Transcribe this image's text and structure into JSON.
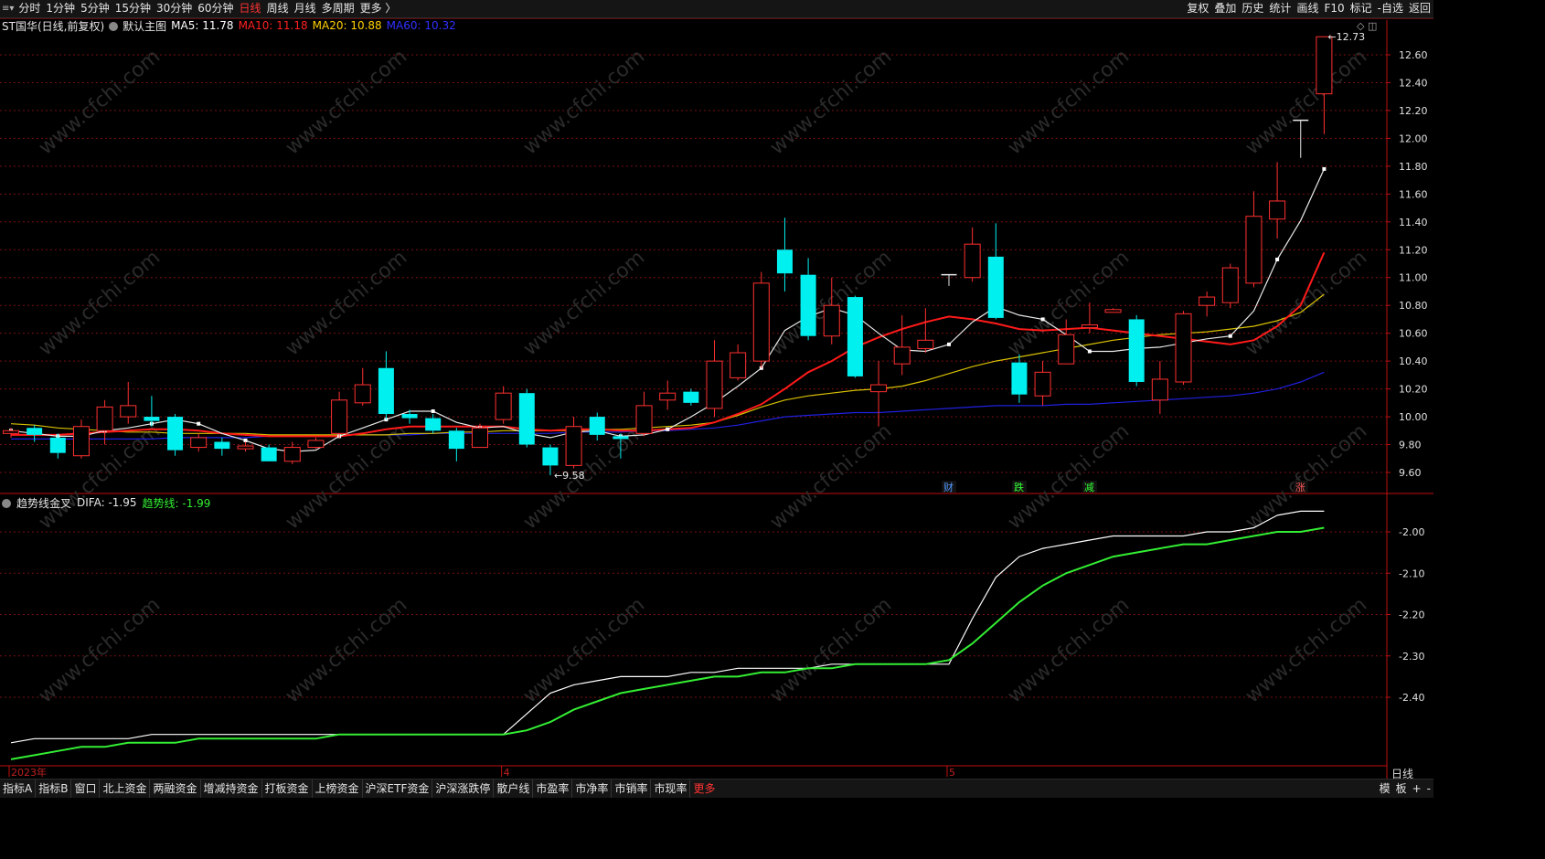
{
  "toolbar": {
    "left": [
      "分时",
      "1分钟",
      "5分钟",
      "15分钟",
      "30分钟",
      "60分钟",
      "日线",
      "周线",
      "月线",
      "多周期",
      "更多 〉"
    ],
    "active": "日线",
    "right": [
      "复权",
      "叠加",
      "历史",
      "统计",
      "画线",
      "F10",
      "标记",
      "-自选",
      "返回"
    ]
  },
  "info": {
    "stock": "ST国华(日线,前复权)",
    "template": "默认主图",
    "ma5": "MA5: 11.78",
    "ma10": "MA10: 11.18",
    "ma20": "MA20: 10.88",
    "ma60": "MA60: 10.32",
    "colors": {
      "ma5": "#ffffff",
      "ma10": "#ff2020",
      "ma20": "#ffd000",
      "ma60": "#3030ff"
    }
  },
  "sub_info": {
    "name": "趋势线金叉",
    "difa": "DIFA: -1.95",
    "trend": "趋势线: -1.99"
  },
  "bottom": {
    "tabs": [
      "指标A",
      "指标B",
      "窗口",
      "北上资金",
      "两融资金",
      "增减持资金",
      "打板资金",
      "上榜资金",
      "沪深ETF资金",
      "沪深涨跌停",
      "散户线",
      "市盈率",
      "市净率",
      "市销率",
      "市现率",
      "更多"
    ],
    "right": [
      "模",
      "板",
      "+",
      "-"
    ],
    "period": "日线"
  },
  "chart_data": [
    {
      "type": "candlestick",
      "y_ticks": [
        "12.60",
        "12.40",
        "12.20",
        "12.00",
        "11.80",
        "11.60",
        "11.40",
        "11.20",
        "11.00",
        "10.80",
        "10.60",
        "10.40",
        "10.20",
        "10.00",
        "9.80",
        "9.60"
      ],
      "ylim": [
        9.5,
        12.8
      ],
      "x_labels": [
        {
          "index": 0,
          "label": "2023年"
        },
        {
          "index": 21,
          "label": "4"
        },
        {
          "index": 40,
          "label": "5"
        }
      ],
      "annotations": [
        {
          "text": "12.73",
          "index": 56,
          "value": 12.73
        },
        {
          "text": "9.58",
          "index": 23,
          "value": 9.58
        }
      ],
      "markers": [
        {
          "text": "财",
          "index": 40,
          "color": "#5599ff"
        },
        {
          "text": "跌",
          "index": 43,
          "color": "#33ff33"
        },
        {
          "text": "减",
          "index": 46,
          "color": "#33ff33"
        },
        {
          "text": "涨",
          "index": 55,
          "color": "#ff5555"
        }
      ],
      "candles": [
        {
          "o": 9.88,
          "c": 9.9,
          "h": 9.92,
          "l": 9.85
        },
        {
          "o": 9.92,
          "c": 9.87,
          "h": 9.94,
          "l": 9.82
        },
        {
          "o": 9.85,
          "c": 9.74,
          "h": 9.88,
          "l": 9.7
        },
        {
          "o": 9.72,
          "c": 9.93,
          "h": 9.98,
          "l": 9.7
        },
        {
          "o": 9.9,
          "c": 10.07,
          "h": 10.12,
          "l": 9.8
        },
        {
          "o": 10.0,
          "c": 10.08,
          "h": 10.25,
          "l": 9.95
        },
        {
          "o": 10.0,
          "c": 9.97,
          "h": 10.15,
          "l": 9.93
        },
        {
          "o": 10.0,
          "c": 9.76,
          "h": 10.02,
          "l": 9.72
        },
        {
          "o": 9.78,
          "c": 9.85,
          "h": 9.88,
          "l": 9.75
        },
        {
          "o": 9.82,
          "c": 9.77,
          "h": 9.85,
          "l": 9.72
        },
        {
          "o": 9.77,
          "c": 9.79,
          "h": 9.82,
          "l": 9.75
        },
        {
          "o": 9.78,
          "c": 9.68,
          "h": 9.8,
          "l": 9.68
        },
        {
          "o": 9.68,
          "c": 9.78,
          "h": 9.82,
          "l": 9.66
        },
        {
          "o": 9.78,
          "c": 9.83,
          "h": 9.85,
          "l": 9.77
        },
        {
          "o": 9.88,
          "c": 10.12,
          "h": 10.18,
          "l": 9.85
        },
        {
          "o": 10.1,
          "c": 10.23,
          "h": 10.35,
          "l": 10.08
        },
        {
          "o": 10.35,
          "c": 10.02,
          "h": 10.47,
          "l": 9.98
        },
        {
          "o": 10.02,
          "c": 9.99,
          "h": 10.05,
          "l": 9.95
        },
        {
          "o": 9.99,
          "c": 9.9,
          "h": 10.02,
          "l": 9.88
        },
        {
          "o": 9.9,
          "c": 9.77,
          "h": 9.92,
          "l": 9.68
        },
        {
          "o": 9.78,
          "c": 9.92,
          "h": 9.95,
          "l": 9.78
        },
        {
          "o": 9.98,
          "c": 10.17,
          "h": 10.22,
          "l": 9.95
        },
        {
          "o": 10.17,
          "c": 9.8,
          "h": 10.2,
          "l": 9.78
        },
        {
          "o": 9.78,
          "c": 9.65,
          "h": 9.8,
          "l": 9.58
        },
        {
          "o": 9.65,
          "c": 9.93,
          "h": 10.0,
          "l": 9.63
        },
        {
          "o": 10.0,
          "c": 9.87,
          "h": 10.03,
          "l": 9.83
        },
        {
          "o": 9.86,
          "c": 9.84,
          "h": 9.88,
          "l": 9.7
        },
        {
          "o": 9.88,
          "c": 10.08,
          "h": 10.18,
          "l": 9.86
        },
        {
          "o": 10.12,
          "c": 10.17,
          "h": 10.26,
          "l": 10.05
        },
        {
          "o": 10.18,
          "c": 10.1,
          "h": 10.2,
          "l": 10.08
        },
        {
          "o": 10.06,
          "c": 10.4,
          "h": 10.55,
          "l": 10.0
        },
        {
          "o": 10.28,
          "c": 10.46,
          "h": 10.52,
          "l": 10.26
        },
        {
          "o": 10.4,
          "c": 10.96,
          "h": 11.04,
          "l": 10.35
        },
        {
          "o": 11.2,
          "c": 11.03,
          "h": 11.43,
          "l": 10.9
        },
        {
          "o": 11.02,
          "c": 10.58,
          "h": 11.14,
          "l": 10.55
        },
        {
          "o": 10.58,
          "c": 10.8,
          "h": 11.0,
          "l": 10.52
        },
        {
          "o": 10.86,
          "c": 10.29,
          "h": 10.87,
          "l": 10.28
        },
        {
          "o": 10.18,
          "c": 10.23,
          "h": 10.4,
          "l": 9.93
        },
        {
          "o": 10.38,
          "c": 10.5,
          "h": 10.73,
          "l": 10.3
        },
        {
          "o": 10.49,
          "c": 10.55,
          "h": 10.78,
          "l": 10.46
        },
        {
          "o": 11.02,
          "c": 11.02,
          "h": 11.02,
          "l": 10.94
        },
        {
          "o": 11.0,
          "c": 11.24,
          "h": 11.36,
          "l": 10.97
        },
        {
          "o": 11.15,
          "c": 10.71,
          "h": 11.39,
          "l": 10.7
        },
        {
          "o": 10.39,
          "c": 10.16,
          "h": 10.45,
          "l": 10.1
        },
        {
          "o": 10.15,
          "c": 10.32,
          "h": 10.4,
          "l": 10.08
        },
        {
          "o": 10.38,
          "c": 10.59,
          "h": 10.7,
          "l": 10.38
        },
        {
          "o": 10.64,
          "c": 10.66,
          "h": 10.82,
          "l": 10.6
        },
        {
          "o": 10.75,
          "c": 10.77,
          "h": 10.78,
          "l": 10.75
        },
        {
          "o": 10.7,
          "c": 10.25,
          "h": 10.73,
          "l": 10.22
        },
        {
          "o": 10.12,
          "c": 10.27,
          "h": 10.4,
          "l": 10.02
        },
        {
          "o": 10.25,
          "c": 10.74,
          "h": 10.76,
          "l": 10.23
        },
        {
          "o": 10.8,
          "c": 10.86,
          "h": 10.9,
          "l": 10.72
        },
        {
          "o": 10.82,
          "c": 11.07,
          "h": 11.1,
          "l": 10.78
        },
        {
          "o": 10.96,
          "c": 11.44,
          "h": 11.62,
          "l": 10.93
        },
        {
          "o": 11.42,
          "c": 11.55,
          "h": 11.83,
          "l": 11.28
        },
        {
          "o": 12.13,
          "c": 12.13,
          "h": 12.13,
          "l": 11.86
        },
        {
          "o": 12.32,
          "c": 12.73,
          "h": 12.73,
          "l": 12.03
        }
      ],
      "ma5": [
        9.9,
        9.88,
        9.86,
        9.86,
        9.9,
        9.92,
        9.95,
        9.98,
        9.95,
        9.88,
        9.83,
        9.77,
        9.75,
        9.76,
        9.86,
        9.92,
        9.98,
        10.04,
        10.04,
        9.96,
        9.92,
        9.93,
        9.88,
        9.85,
        9.89,
        9.9,
        9.86,
        9.87,
        9.91,
        10.0,
        10.1,
        10.22,
        10.35,
        10.62,
        10.72,
        10.78,
        10.73,
        10.6,
        10.48,
        10.47,
        10.52,
        10.68,
        10.79,
        10.73,
        10.7,
        10.59,
        10.47,
        10.47,
        10.49,
        10.5,
        10.53,
        10.56,
        10.58,
        10.76,
        11.13,
        11.41,
        11.78
      ],
      "ma10": [
        9.87,
        9.87,
        9.87,
        9.88,
        9.89,
        9.9,
        9.91,
        9.91,
        9.9,
        9.88,
        9.87,
        9.86,
        9.86,
        9.86,
        9.86,
        9.88,
        9.91,
        9.93,
        9.93,
        9.93,
        9.93,
        9.93,
        9.91,
        9.9,
        9.91,
        9.91,
        9.9,
        9.9,
        9.91,
        9.92,
        9.96,
        10.02,
        10.09,
        10.2,
        10.32,
        10.4,
        10.5,
        10.57,
        10.63,
        10.68,
        10.72,
        10.7,
        10.67,
        10.63,
        10.62,
        10.63,
        10.64,
        10.62,
        10.6,
        10.58,
        10.56,
        10.54,
        10.52,
        10.55,
        10.65,
        10.8,
        11.18
      ],
      "ma20": [
        9.95,
        9.94,
        9.92,
        9.91,
        9.9,
        9.89,
        9.89,
        9.88,
        9.88,
        9.88,
        9.88,
        9.87,
        9.87,
        9.87,
        9.87,
        9.87,
        9.87,
        9.88,
        9.88,
        9.89,
        9.89,
        9.9,
        9.9,
        9.9,
        9.9,
        9.91,
        9.91,
        9.92,
        9.93,
        9.94,
        9.96,
        10.01,
        10.07,
        10.12,
        10.15,
        10.17,
        10.19,
        10.2,
        10.22,
        10.26,
        10.31,
        10.36,
        10.4,
        10.43,
        10.46,
        10.49,
        10.52,
        10.55,
        10.57,
        10.59,
        10.6,
        10.61,
        10.63,
        10.65,
        10.69,
        10.75,
        10.88
      ],
      "ma60": [
        9.84,
        9.84,
        9.84,
        9.84,
        9.84,
        9.84,
        9.84,
        9.85,
        9.85,
        9.85,
        9.85,
        9.86,
        9.86,
        9.86,
        9.87,
        9.87,
        9.87,
        9.87,
        9.88,
        9.88,
        9.88,
        9.88,
        9.88,
        9.88,
        9.89,
        9.89,
        9.89,
        9.9,
        9.9,
        9.91,
        9.92,
        9.94,
        9.97,
        10.0,
        10.01,
        10.02,
        10.03,
        10.03,
        10.04,
        10.05,
        10.06,
        10.07,
        10.08,
        10.08,
        10.08,
        10.09,
        10.09,
        10.1,
        10.11,
        10.12,
        10.13,
        10.14,
        10.15,
        10.17,
        10.2,
        10.25,
        10.32
      ]
    },
    {
      "type": "line",
      "name": "趋势线金叉",
      "y_ticks": [
        "-2.00",
        "-2.10",
        "-2.20",
        "-2.30",
        "-2.40"
      ],
      "ylim": [
        -2.56,
        -1.96
      ],
      "series": [
        {
          "name": "DIFA",
          "color": "#ffffff",
          "values": [
            -2.51,
            -2.5,
            -2.5,
            -2.5,
            -2.5,
            -2.5,
            -2.49,
            -2.49,
            -2.49,
            -2.49,
            -2.49,
            -2.49,
            -2.49,
            -2.49,
            -2.49,
            -2.49,
            -2.49,
            -2.49,
            -2.49,
            -2.49,
            -2.49,
            -2.49,
            -2.44,
            -2.39,
            -2.37,
            -2.36,
            -2.35,
            -2.35,
            -2.35,
            -2.34,
            -2.34,
            -2.33,
            -2.33,
            -2.33,
            -2.33,
            -2.32,
            -2.32,
            -2.32,
            -2.32,
            -2.32,
            -2.32,
            -2.21,
            -2.11,
            -2.06,
            -2.04,
            -2.03,
            -2.02,
            -2.01,
            -2.01,
            -2.01,
            -2.01,
            -2.0,
            -2.0,
            -1.99,
            -1.96,
            -1.95,
            -1.95
          ]
        },
        {
          "name": "趋势线",
          "color": "#33ee33",
          "values": [
            -2.55,
            -2.54,
            -2.53,
            -2.52,
            -2.52,
            -2.51,
            -2.51,
            -2.51,
            -2.5,
            -2.5,
            -2.5,
            -2.5,
            -2.5,
            -2.5,
            -2.49,
            -2.49,
            -2.49,
            -2.49,
            -2.49,
            -2.49,
            -2.49,
            -2.49,
            -2.48,
            -2.46,
            -2.43,
            -2.41,
            -2.39,
            -2.38,
            -2.37,
            -2.36,
            -2.35,
            -2.35,
            -2.34,
            -2.34,
            -2.33,
            -2.33,
            -2.32,
            -2.32,
            -2.32,
            -2.32,
            -2.31,
            -2.27,
            -2.22,
            -2.17,
            -2.13,
            -2.1,
            -2.08,
            -2.06,
            -2.05,
            -2.04,
            -2.03,
            -2.03,
            -2.02,
            -2.01,
            -2.0,
            -2.0,
            -1.99
          ]
        }
      ]
    }
  ]
}
